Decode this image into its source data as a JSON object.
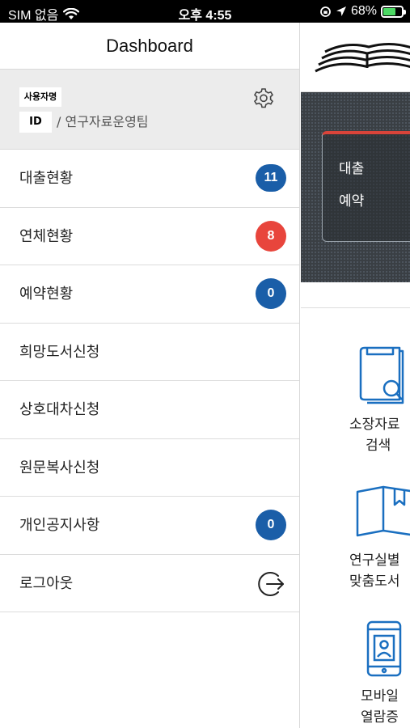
{
  "status_bar": {
    "carrier": "SIM 없음",
    "time": "오후 4:55",
    "battery": "68%",
    "battery_level": 0.68
  },
  "drawer": {
    "title": "Dashboard",
    "user": {
      "name_label": "사용자명",
      "id_label": "ID",
      "team": "/ 연구자료운영팀"
    },
    "menu": [
      {
        "label": "대출현황",
        "badge": "11",
        "badge_color": "#1a5ea8"
      },
      {
        "label": "연체현황",
        "badge": "8",
        "badge_color": "#e8453c"
      },
      {
        "label": "예약현황",
        "badge": "0",
        "badge_color": "#1a5ea8"
      },
      {
        "label": "희망도서신청"
      },
      {
        "label": "상호대차신청"
      },
      {
        "label": "원문복사신청"
      },
      {
        "label": "개인공지사항",
        "badge": "0",
        "badge_color": "#1a5ea8"
      },
      {
        "label": "로그아웃",
        "icon": "logout-icon"
      }
    ]
  },
  "background": {
    "panel_items": [
      "대출",
      "예약"
    ],
    "tiles": [
      {
        "icon": "book-search-icon",
        "line1": "소장자료",
        "line2": "검색"
      },
      {
        "icon": "open-book-icon",
        "line1": "연구실별",
        "line2": "맞춤도서"
      },
      {
        "icon": "mobile-id-icon",
        "line1": "모바일",
        "line2": "열람증"
      }
    ]
  }
}
